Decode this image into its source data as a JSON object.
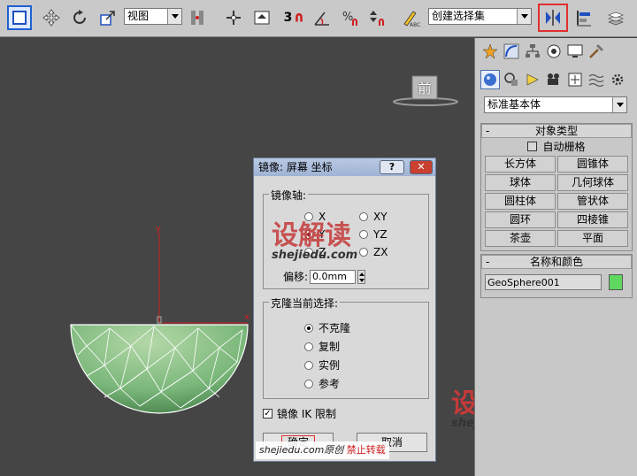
{
  "toolbar": {
    "view_combo": "视图",
    "selection_set_combo": "创建选择集",
    "snap_number": "3"
  },
  "viewport": {
    "view_cube_label": "前",
    "axis_y": "y",
    "axis_x": "x"
  },
  "command_panel": {
    "category_combo": "标准基本体",
    "object_type_rollout": {
      "title": "对象类型",
      "autogrid_label": "自动栅格",
      "buttons": [
        "长方体",
        "圆锥体",
        "球体",
        "几何球体",
        "圆柱体",
        "管状体",
        "圆环",
        "四棱锥",
        "茶壶",
        "平面"
      ]
    },
    "name_color_rollout": {
      "title": "名称和颜色",
      "object_name": "GeoSphere001",
      "color": "#5ed85e"
    }
  },
  "mirror_dialog": {
    "title": "镜像: 屏幕 坐标",
    "help_button": "?",
    "mirror_axis_group": "镜像轴:",
    "axes": [
      {
        "label": "X",
        "selected": false
      },
      {
        "label": "Y",
        "selected": false
      },
      {
        "label": "Z",
        "selected": false
      },
      {
        "label": "XY",
        "selected": false
      },
      {
        "label": "YZ",
        "selected": false
      },
      {
        "label": "ZX",
        "selected": false
      }
    ],
    "offset_label": "偏移:",
    "offset_value": "0.0mm",
    "clone_group": "克隆当前选择:",
    "clone_options": [
      {
        "label": "不克隆",
        "selected": true
      },
      {
        "label": "复制",
        "selected": false
      },
      {
        "label": "实例",
        "selected": false
      },
      {
        "label": "参考",
        "selected": false
      }
    ],
    "mirror_ik_label": "镜像 IK 限制",
    "mirror_ik_checked": true,
    "ok_button": "确定",
    "cancel_button": "取消"
  },
  "watermarks": {
    "logo_text": "设解读",
    "url": "shejiedu.com",
    "caption_prefix": "shejiedu.com原创",
    "caption_suffix": "禁止转载"
  }
}
